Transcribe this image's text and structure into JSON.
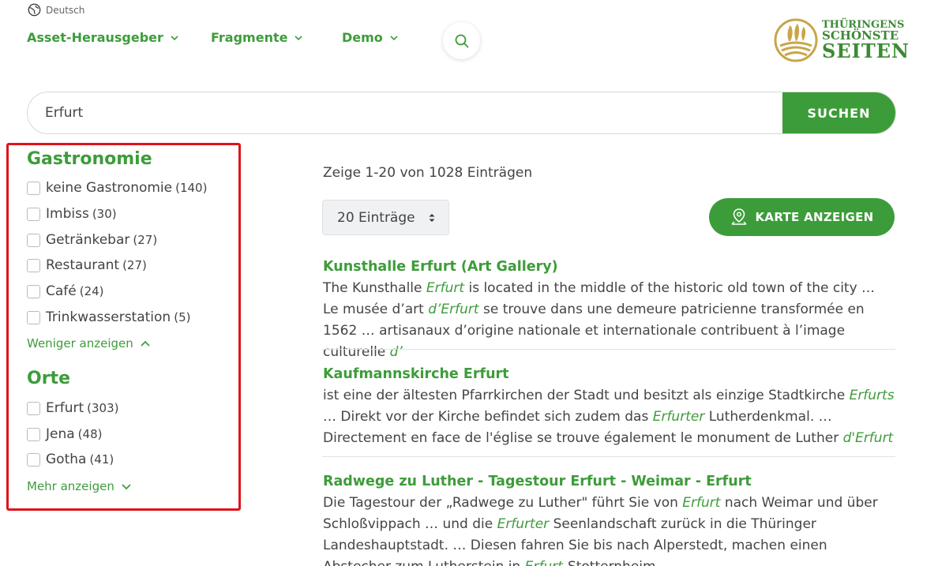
{
  "language": {
    "label": "Deutsch",
    "icon": "globe-icon"
  },
  "nav": [
    {
      "label": "Asset-Herausgeber",
      "icon": "chevron-down-icon"
    },
    {
      "label": "Fragmente",
      "icon": "chevron-down-icon"
    },
    {
      "label": "Demo",
      "icon": "chevron-down-icon"
    }
  ],
  "logo": {
    "line1": "THÜRINGENS",
    "line2": "SCHÖNSTE",
    "line3": "SEITEN"
  },
  "search": {
    "value": "Erfurt",
    "button_label": "SUCHEN"
  },
  "filters": {
    "gastronomie": {
      "title": "Gastronomie",
      "options": [
        {
          "label": "keine Gastronomie",
          "count": "(140)"
        },
        {
          "label": "Imbiss",
          "count": "(30)"
        },
        {
          "label": "Getränkebar",
          "count": "(27)"
        },
        {
          "label": "Restaurant",
          "count": "(27)"
        },
        {
          "label": "Café",
          "count": "(24)"
        },
        {
          "label": "Trinkwasserstation",
          "count": "(5)"
        }
      ],
      "toggle_label": "Weniger anzeigen"
    },
    "orte": {
      "title": "Orte",
      "options": [
        {
          "label": "Erfurt",
          "count": "(303)"
        },
        {
          "label": "Jena",
          "count": "(48)"
        },
        {
          "label": "Gotha",
          "count": "(41)"
        }
      ],
      "toggle_label": "Mehr anzeigen"
    }
  },
  "results_summary": "Zeige 1-20 von 1028 Einträgen",
  "entries_select": {
    "value": "20 Einträge"
  },
  "map_button": {
    "label": "KARTE ANZEIGEN"
  },
  "results": [
    {
      "title": "Kunsthalle Erfurt (Art Gallery)",
      "snippet": [
        {
          "t": "The Kunsthalle "
        },
        {
          "t": "Erfurt",
          "em": true
        },
        {
          "t": " is located in the middle of the historic old town of the city … Le musée d’art "
        },
        {
          "t": "d’Erfurt",
          "em": true
        },
        {
          "t": " se trouve dans une demeure patricienne transformée en 1562 … artisanaux d’origine nationale et internationale contribuent à l’image culturelle "
        },
        {
          "t": "d’",
          "em": true
        }
      ]
    },
    {
      "title": "Kaufmannskirche Erfurt",
      "snippet": [
        {
          "t": "ist eine der ältesten Pfarrkirchen der Stadt und besitzt als einzige Stadtkirche "
        },
        {
          "t": "Erfurts",
          "em": true
        },
        {
          "t": " … Direkt vor der Kirche befindet sich zudem das "
        },
        {
          "t": "Erfurter",
          "em": true
        },
        {
          "t": " Lutherdenkmal. … Directement en face de l'église se trouve également le monument de Luther "
        },
        {
          "t": "d'Erfurt",
          "em": true
        }
      ]
    },
    {
      "title": "Radwege zu Luther - Tagestour Erfurt - Weimar - Erfurt",
      "snippet": [
        {
          "t": "Die Tagestour der „Radwege zu Luther\" führt Sie von "
        },
        {
          "t": "Erfurt",
          "em": true
        },
        {
          "t": " nach Weimar und über Schloßvippach … und die "
        },
        {
          "t": "Erfurter",
          "em": true
        },
        {
          "t": " Seenlandschaft zurück in die Thüringer Landeshauptstadt. … Diesen fahren Sie bis nach Alperstedt, machen einen Abstecher zum Lutherstein in "
        },
        {
          "t": "Erfurt",
          "em": true
        },
        {
          "t": "-Stotternheim."
        }
      ]
    }
  ],
  "colors": {
    "accent": "#3d9c3a",
    "highlight_border": "#e0131a",
    "text": "#444444"
  }
}
